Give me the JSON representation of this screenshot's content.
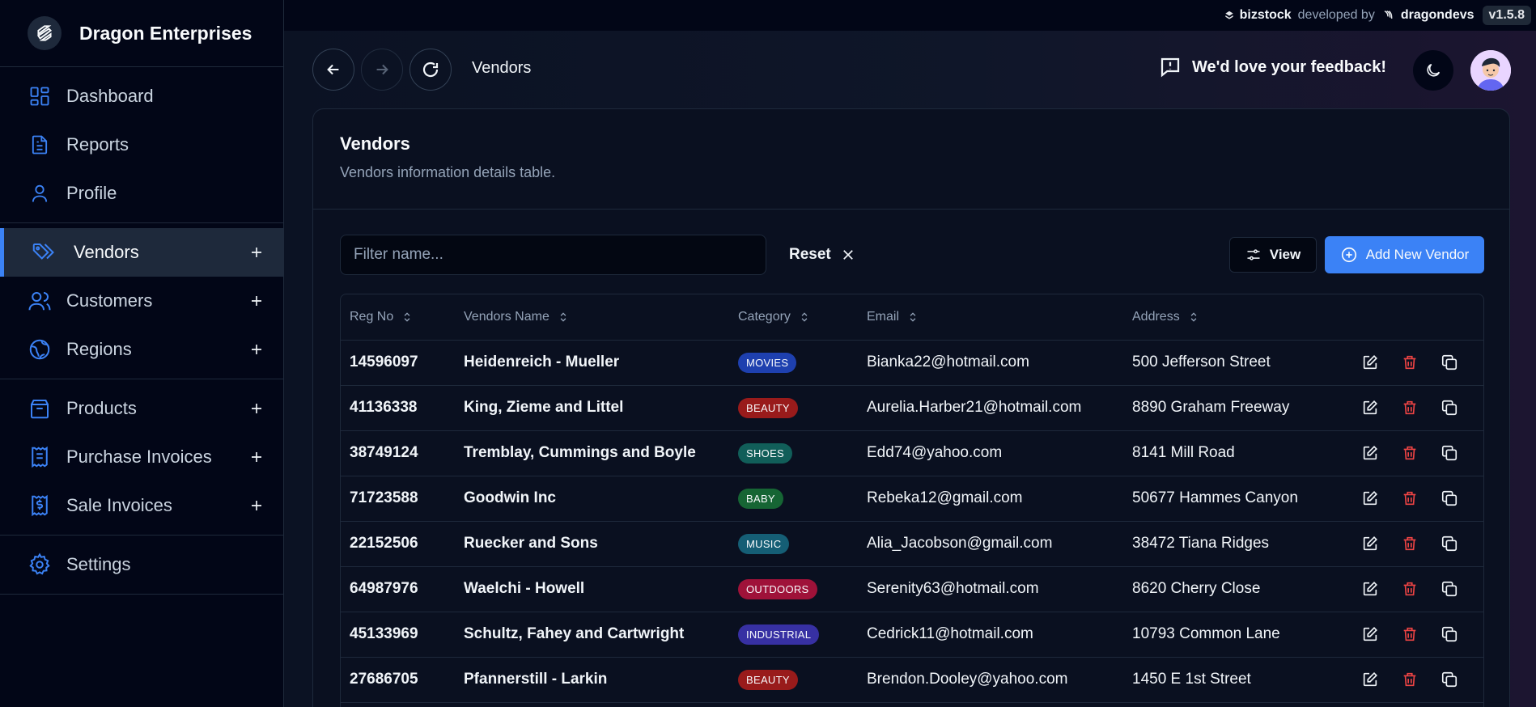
{
  "sidebar": {
    "brand": "Dragon Enterprises",
    "items": [
      {
        "label": "Dashboard",
        "icon": "dashboard-icon"
      },
      {
        "label": "Reports",
        "icon": "document-icon"
      },
      {
        "label": "Profile",
        "icon": "user-icon"
      },
      {
        "label": "Vendors",
        "icon": "tags-icon",
        "active": true
      },
      {
        "label": "Customers",
        "icon": "users-icon"
      },
      {
        "label": "Regions",
        "icon": "globe-icon"
      },
      {
        "label": "Products",
        "icon": "box-icon"
      },
      {
        "label": "Purchase Invoices",
        "icon": "receipt-icon"
      },
      {
        "label": "Sale Invoices",
        "icon": "dollar-receipt-icon"
      },
      {
        "label": "Settings",
        "icon": "gear-icon"
      }
    ]
  },
  "topbar": {
    "product": "bizstock",
    "developed_by": "developed by",
    "developer": "dragondevs",
    "version": "v1.5.8"
  },
  "header": {
    "page": "Vendors",
    "feedback": "We'd love your feedback!"
  },
  "card": {
    "title": "Vendors",
    "description": "Vendors information details table."
  },
  "toolbar": {
    "filter_placeholder": "Filter name...",
    "reset": "Reset",
    "view": "View",
    "add": "Add New Vendor"
  },
  "table": {
    "columns": [
      "Reg No",
      "Vendors Name",
      "Category",
      "Email",
      "Address"
    ],
    "rows": [
      {
        "reg": "14596097",
        "name": "Heidenreich - Mueller",
        "category": "MOVIES",
        "email": "Bianka22@hotmail.com",
        "address": "500 Jefferson Street"
      },
      {
        "reg": "41136338",
        "name": "King, Zieme and Littel",
        "category": "BEAUTY",
        "email": "Aurelia.Harber21@hotmail.com",
        "address": "8890 Graham Freeway"
      },
      {
        "reg": "38749124",
        "name": "Tremblay, Cummings and Boyle",
        "category": "SHOES",
        "email": "Edd74@yahoo.com",
        "address": "8141 Mill Road"
      },
      {
        "reg": "71723588",
        "name": "Goodwin Inc",
        "category": "BABY",
        "email": "Rebeka12@gmail.com",
        "address": "50677 Hammes Canyon"
      },
      {
        "reg": "22152506",
        "name": "Ruecker and Sons",
        "category": "MUSIC",
        "email": "Alia_Jacobson@gmail.com",
        "address": "38472 Tiana Ridges"
      },
      {
        "reg": "64987976",
        "name": "Waelchi - Howell",
        "category": "OUTDOORS",
        "email": "Serenity63@hotmail.com",
        "address": "8620 Cherry Close"
      },
      {
        "reg": "45133969",
        "name": "Schultz, Fahey and Cartwright",
        "category": "INDUSTRIAL",
        "email": "Cedrick11@hotmail.com",
        "address": "10793 Common Lane"
      },
      {
        "reg": "27686705",
        "name": "Pfannerstill - Larkin",
        "category": "BEAUTY",
        "email": "Brendon.Dooley@yahoo.com",
        "address": "1450 E 1st Street"
      }
    ]
  },
  "category_colors": {
    "MOVIES": "#1e40af",
    "BEAUTY": "#991b1b",
    "SHOES": "#115e59",
    "BABY": "#166534",
    "MUSIC": "#155e75",
    "OUTDOORS": "#9f1239",
    "INDUSTRIAL": "#3730a3"
  },
  "colors": {
    "accent": "#3b82f6",
    "danger": "#ef4444"
  }
}
